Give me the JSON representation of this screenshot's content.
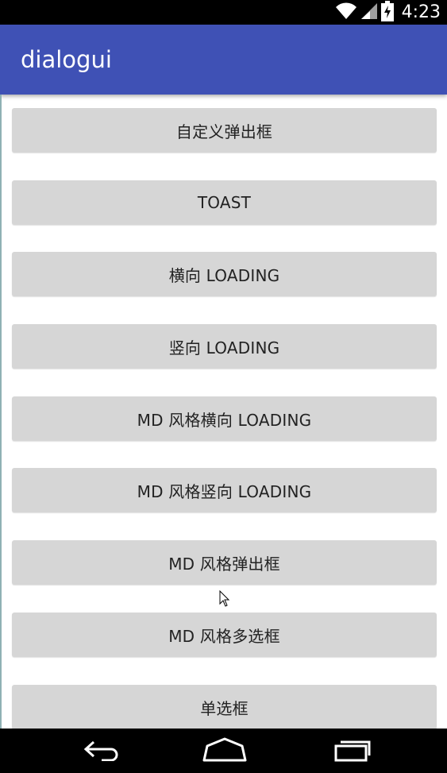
{
  "status_bar": {
    "time": "4:23",
    "icons": [
      "wifi-icon",
      "cell-signal-icon",
      "battery-charging-icon"
    ]
  },
  "app_bar": {
    "title": "dialogui",
    "color": "#3f51b5"
  },
  "buttons": [
    {
      "label": "自定义弹出框"
    },
    {
      "label": "TOAST"
    },
    {
      "label": "横向 LOADING"
    },
    {
      "label": "竖向 LOADING"
    },
    {
      "label": "MD 风格横向 LOADING"
    },
    {
      "label": "MD 风格竖向 LOADING"
    },
    {
      "label": "MD 风格弹出框"
    },
    {
      "label": "MD 风格多选框"
    },
    {
      "label": "单选框"
    }
  ],
  "nav_bar": {
    "icons": [
      "back-icon",
      "home-icon",
      "recents-icon"
    ]
  }
}
